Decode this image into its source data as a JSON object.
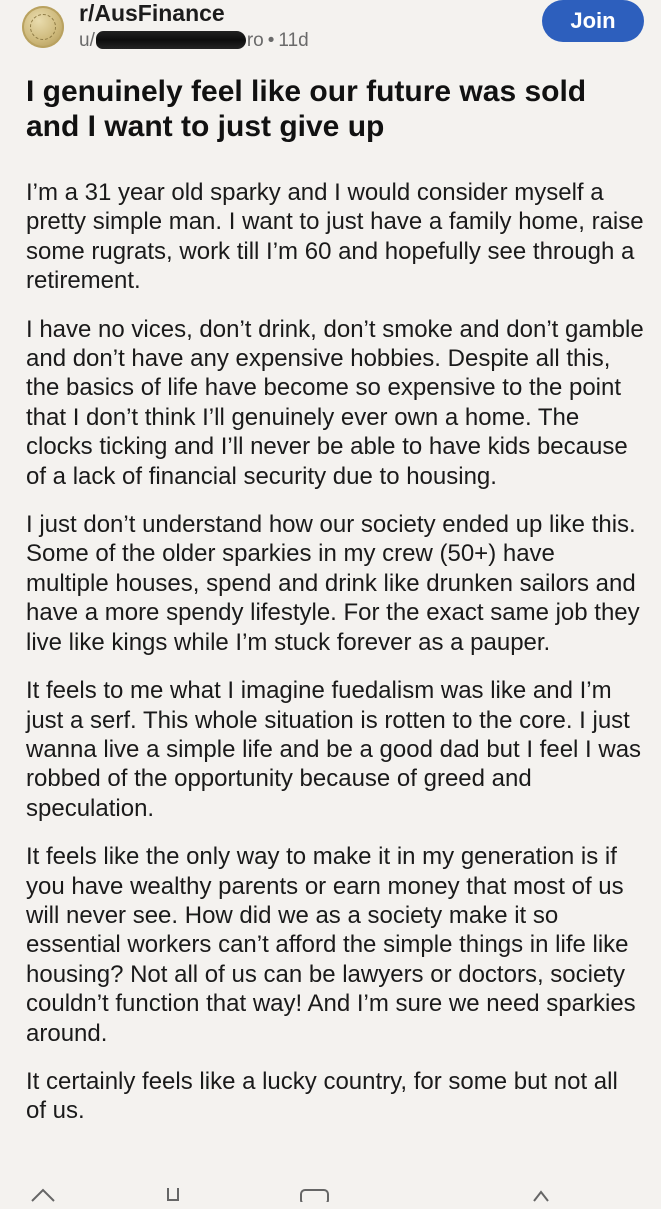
{
  "header": {
    "subreddit": "r/AusFinance",
    "user_prefix": "u/",
    "user_tail": "ro",
    "time": "11d",
    "join_label": "Join"
  },
  "post": {
    "title": "I genuinely feel like our future was sold and I want to just give up",
    "paragraphs": [
      "I’m a 31 year old sparky and I would consider myself a pretty simple man. I want to just have a family home, raise some rugrats, work till I’m 60 and hopefully see through a retirement.",
      "I have no vices, don’t drink, don’t smoke and don’t gamble and don’t have any expensive hobbies. Despite all this, the basics of life have become so expensive to the point that I don’t think I’ll genuinely ever own a home. The clocks ticking and I’ll never be able to have kids because of a lack of financial security due to housing.",
      "I just don’t understand how our society ended up like this. Some of the older sparkies in my crew (50+) have multiple houses, spend and drink like drunken sailors and have a more spendy lifestyle. For the exact same job they live like kings while I’m stuck forever as a pauper.",
      "It feels to me what I imagine fuedalism was like and I’m just a serf. This whole situation is rotten to the core. I just wanna live a simple life and be a good dad but I feel I was robbed of the opportunity because of greed and speculation.",
      "It feels like the only way to make it in my generation is if you have wealthy parents or earn money that most of us will never see. How did we as a society make it so essential workers can’t afford the simple things in life like housing? Not all of us can be lawyers or doctors, society couldn’t function that way! And I’m sure we need sparkies around.",
      "It certainly feels like a lucky country, for some but not all of us."
    ]
  },
  "actions": {
    "icons": [
      "upvote-icon",
      "downvote-icon",
      "comment-icon",
      "share-icon"
    ]
  }
}
